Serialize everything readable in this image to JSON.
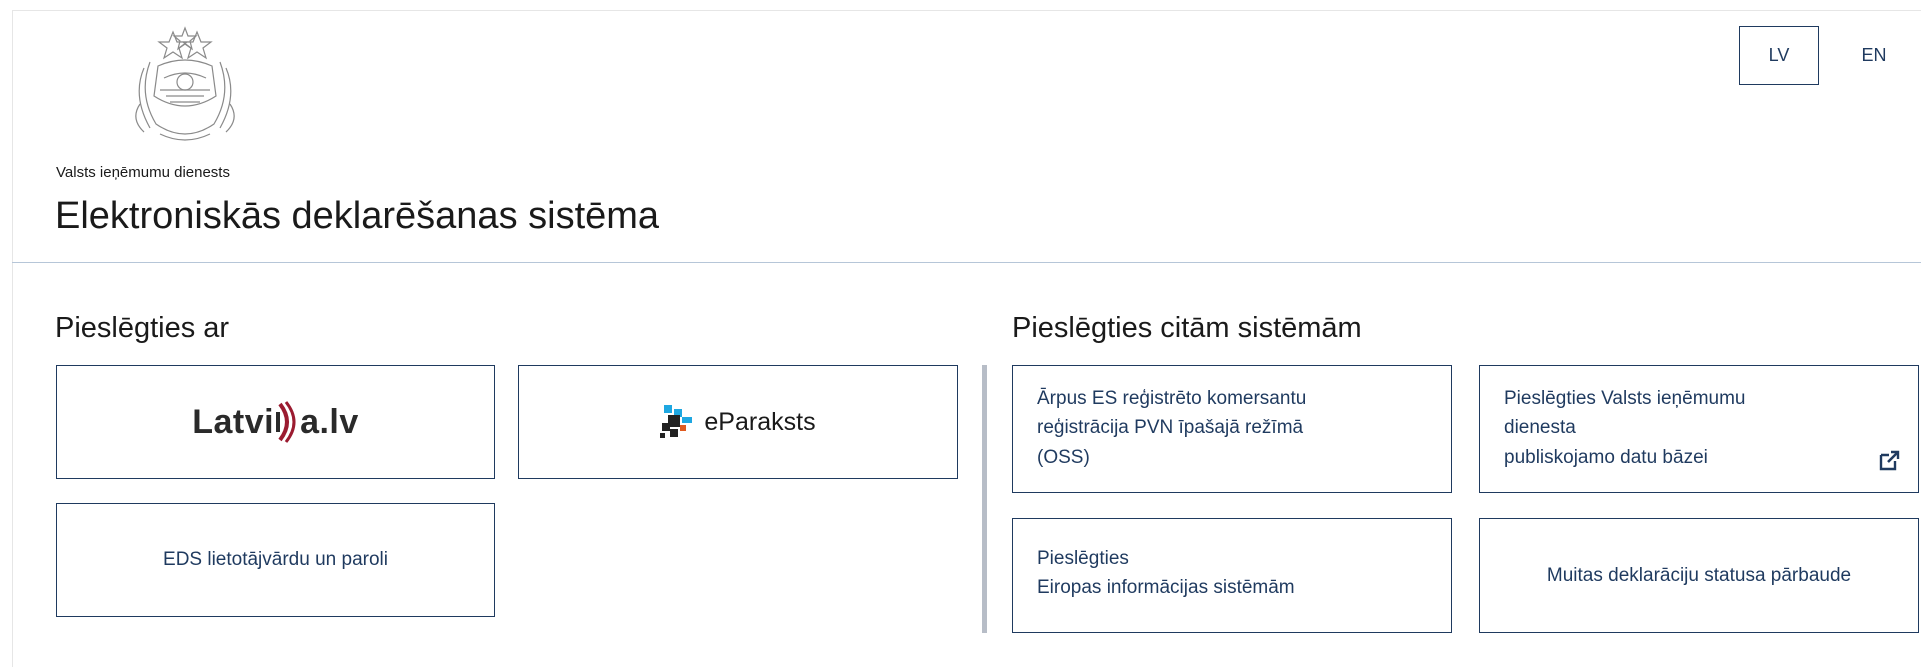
{
  "header": {
    "agency_name": "Valsts ieņēmumu dienests",
    "system_title": "Elektroniskās deklarēšanas sistēma",
    "languages": [
      {
        "code": "LV",
        "active": true
      },
      {
        "code": "EN",
        "active": false
      }
    ]
  },
  "login": {
    "title": "Pieslēgties ar",
    "latvija": {
      "text_left": "Latvi",
      "text_right": "a.lv"
    },
    "eparaksts": {
      "label": "eParaksts"
    },
    "eds": {
      "label": "EDS lietotājvārdu un paroli"
    }
  },
  "other": {
    "title": "Pieslēgties citām sistēmām",
    "oss": {
      "lines": [
        "Ārpus ES reģistrēto komersantu",
        "reģistrācija PVN īpašajā režīmā",
        "(OSS)"
      ]
    },
    "public_data": {
      "lines": [
        "Pieslēgties Valsts ieņēmumu",
        "dienesta",
        "publiskojamo datu bāzei"
      ],
      "icon": "external-link-icon"
    },
    "eu_systems": {
      "lines": [
        "Pieslēgties",
        "Eiropas informācijas sistēmām"
      ]
    },
    "customs": {
      "label": "Muitas deklarāciju statusa pārbaude"
    }
  },
  "colors": {
    "accent": "#1f3a5f",
    "divider": "#b6c6d8",
    "latvija_mark": "#9b1b30"
  }
}
